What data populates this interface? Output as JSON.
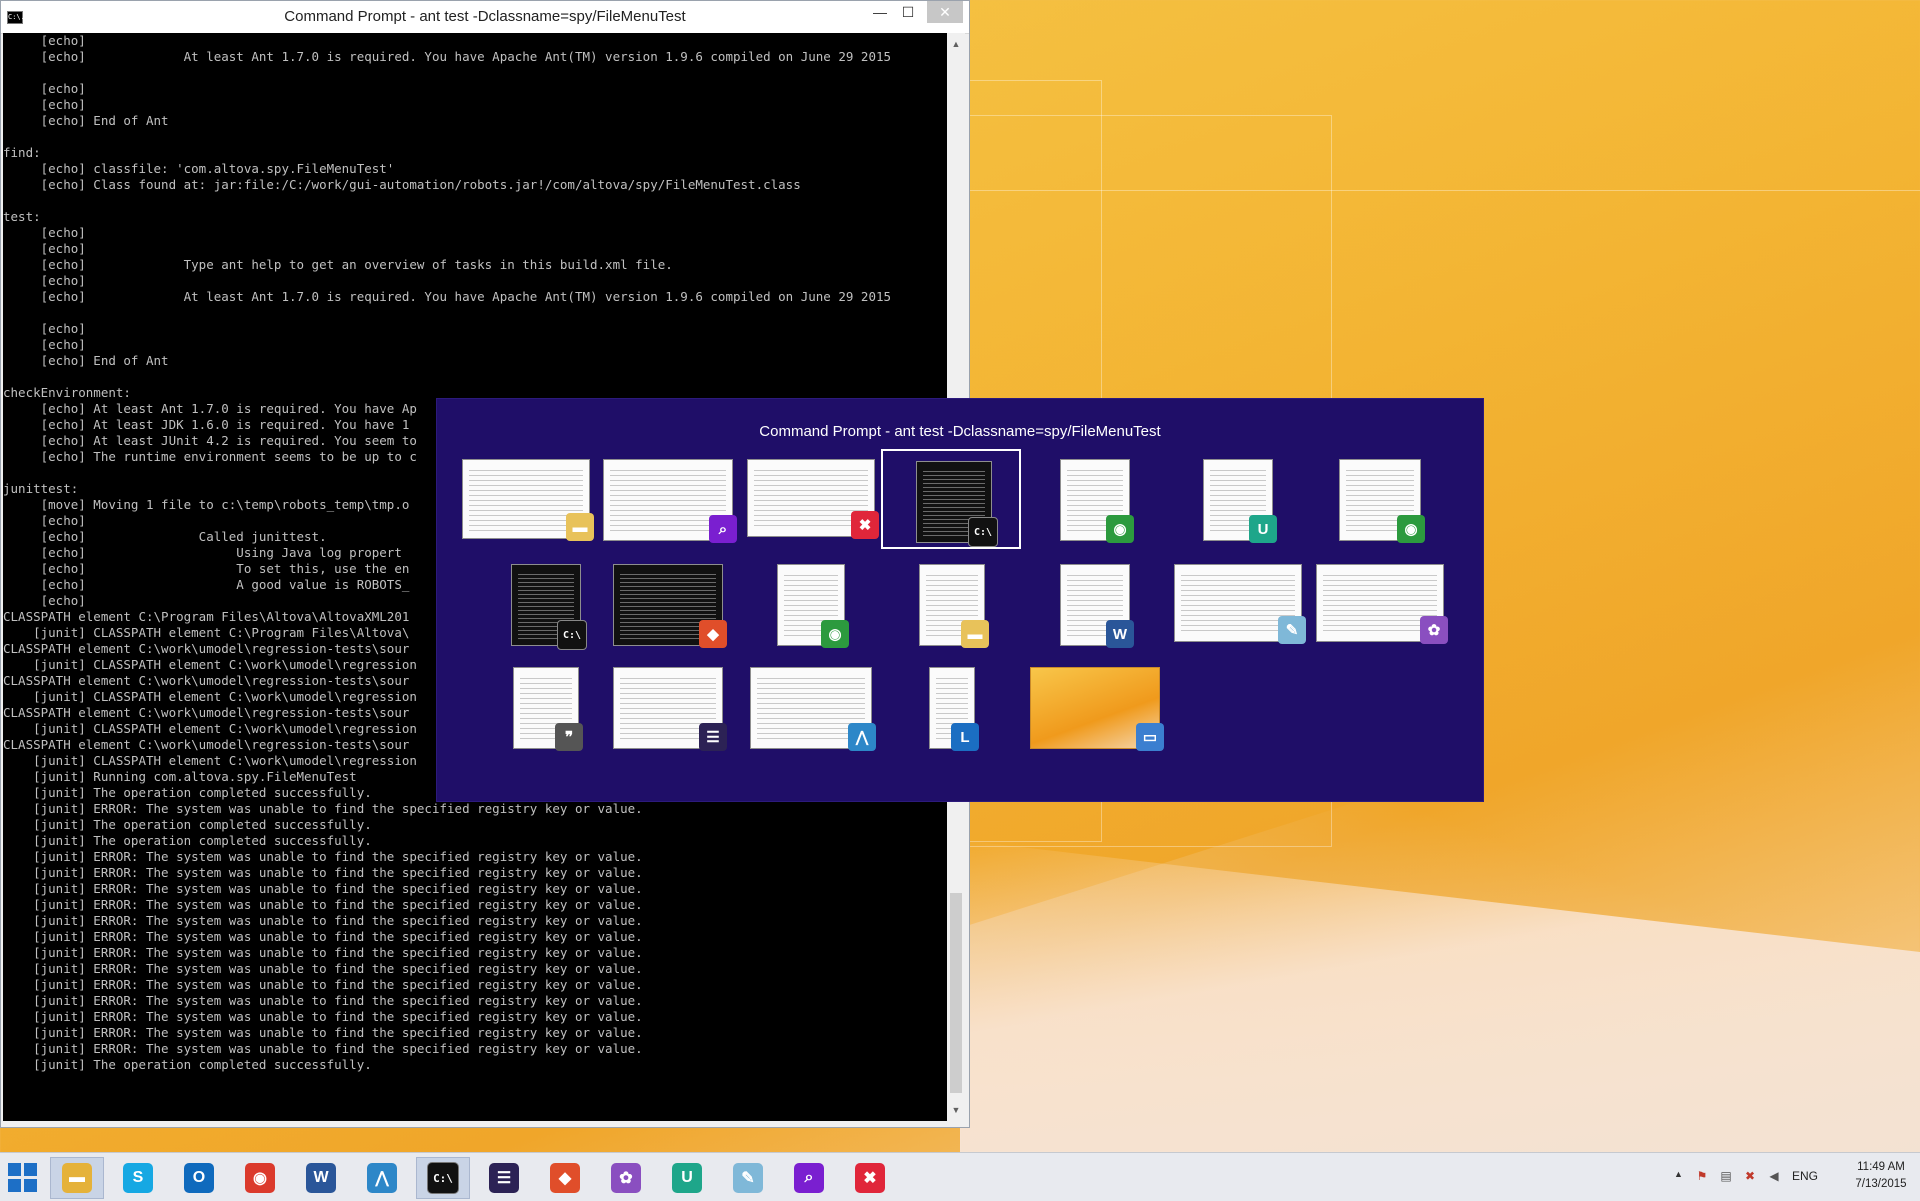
{
  "window": {
    "title": "Command Prompt - ant  test -Dclassname=spy/FileMenuTest",
    "app_icon": "C:\\.",
    "minimize_label": "—",
    "maximize_label": "☐",
    "close_label": "✕"
  },
  "console": {
    "text": "     [echo]\n     [echo]             At least Ant 1.7.0 is required. You have Apache Ant(TM) version 1.9.6 compiled on June 29 2015\n\n     [echo]\n     [echo]\n     [echo] End of Ant\n\nfind:\n     [echo] classfile: 'com.altova.spy.FileMenuTest'\n     [echo] Class found at: jar:file:/C:/work/gui-automation/robots.jar!/com/altova/spy/FileMenuTest.class\n\ntest:\n     [echo]\n     [echo]\n     [echo]             Type ant help to get an overview of tasks in this build.xml file.\n     [echo]\n     [echo]             At least Ant 1.7.0 is required. You have Apache Ant(TM) version 1.9.6 compiled on June 29 2015\n\n     [echo]\n     [echo]\n     [echo] End of Ant\n\ncheckEnvironment:\n     [echo] At least Ant 1.7.0 is required. You have Ap\n     [echo] At least JDK 1.6.0 is required. You have 1\n     [echo] At least JUnit 4.2 is required. You seem to\n     [echo] The runtime environment seems to be up to c\n\njunittest:\n     [move] Moving 1 file to c:\\temp\\robots_temp\\tmp.o\n     [echo]\n     [echo]               Called junittest.\n     [echo]                    Using Java log propert\n     [echo]                    To set this, use the en\n     [echo]                    A good value is ROBOTS_\n     [echo]\nCLASSPATH element C:\\Program Files\\Altova\\AltovaXML201\n    [junit] CLASSPATH element C:\\Program Files\\Altova\\\nCLASSPATH element C:\\work\\umodel\\regression-tests\\sour\n    [junit] CLASSPATH element C:\\work\\umodel\\regression\nCLASSPATH element C:\\work\\umodel\\regression-tests\\sour\n    [junit] CLASSPATH element C:\\work\\umodel\\regression\nCLASSPATH element C:\\work\\umodel\\regression-tests\\sour\n    [junit] CLASSPATH element C:\\work\\umodel\\regression\nCLASSPATH element C:\\work\\umodel\\regression-tests\\sour\n    [junit] CLASSPATH element C:\\work\\umodel\\regression\n    [junit] Running com.altova.spy.FileMenuTest\n    [junit] The operation completed successfully.\n    [junit] ERROR: The system was unable to find the specified registry key or value.\n    [junit] The operation completed successfully.\n    [junit] The operation completed successfully.\n    [junit] ERROR: The system was unable to find the specified registry key or value.\n    [junit] ERROR: The system was unable to find the specified registry key or value.\n    [junit] ERROR: The system was unable to find the specified registry key or value.\n    [junit] ERROR: The system was unable to find the specified registry key or value.\n    [junit] ERROR: The system was unable to find the specified registry key or value.\n    [junit] ERROR: The system was unable to find the specified registry key or value.\n    [junit] ERROR: The system was unable to find the specified registry key or value.\n    [junit] ERROR: The system was unable to find the specified registry key or value.\n    [junit] ERROR: The system was unable to find the specified registry key or value.\n    [junit] ERROR: The system was unable to find the specified registry key or value.\n    [junit] ERROR: The system was unable to find the specified registry key or value.\n    [junit] ERROR: The system was unable to find the specified registry key or value.\n    [junit] ERROR: The system was unable to find the specified registry key or value.\n    [junit] The operation completed successfully."
  },
  "switcher": {
    "title": "Command Prompt - ant  test -Dclassname=spy/FileMenuTest",
    "background": "#1f0e68",
    "items": [
      {
        "name": "explorer-window-thumbnail",
        "icon": "folder-icon",
        "glyph": "▬",
        "color": "#e8c25a",
        "dark": false,
        "selected": false
      },
      {
        "name": "search-app-thumbnail",
        "icon": "magnifier-icon",
        "glyph": "⌕",
        "color": "#7a1fd0",
        "dark": false,
        "selected": false
      },
      {
        "name": "xmlspy-thumbnail",
        "icon": "xmlspy-icon",
        "glyph": "✖",
        "color": "#e0263a",
        "dark": false,
        "selected": false
      },
      {
        "name": "command-prompt-thumbnail",
        "icon": "command-prompt-icon",
        "glyph": "C:\\",
        "color": "#111111",
        "dark": true,
        "selected": true
      },
      {
        "name": "chrome-console-thumbnail",
        "icon": "chrome-icon",
        "glyph": "◉",
        "color": "#2c9a3e",
        "dark": false,
        "selected": false
      },
      {
        "name": "umodel-thumbnail",
        "icon": "umodel-icon",
        "glyph": "U",
        "color": "#1ea68a",
        "dark": false,
        "selected": false
      },
      {
        "name": "chrome-document-thumbnail",
        "icon": "chrome-icon",
        "glyph": "◉",
        "color": "#2c9a3e",
        "dark": false,
        "selected": false
      },
      {
        "name": "command-prompt-2-thumbnail",
        "icon": "command-prompt-icon",
        "glyph": "C:\\",
        "color": "#111111",
        "dark": true,
        "selected": false
      },
      {
        "name": "git-bash-thumbnail",
        "icon": "git-icon",
        "glyph": "◆",
        "color": "#e04e2a",
        "dark": true,
        "selected": false
      },
      {
        "name": "chrome-page-thumbnail",
        "icon": "chrome-icon",
        "glyph": "◉",
        "color": "#2c9a3e",
        "dark": false,
        "selected": false
      },
      {
        "name": "explorer-folder-thumbnail",
        "icon": "folder-icon",
        "glyph": "▬",
        "color": "#e8c25a",
        "dark": false,
        "selected": false
      },
      {
        "name": "word-document-thumbnail",
        "icon": "word-icon",
        "glyph": "W",
        "color": "#2a5699",
        "dark": false,
        "selected": false
      },
      {
        "name": "notepad-thumbnail",
        "icon": "notepad-icon",
        "glyph": "✎",
        "color": "#7fb8d8",
        "dark": false,
        "selected": false
      },
      {
        "name": "paint-app-thumbnail",
        "icon": "paw-icon",
        "glyph": "✿",
        "color": "#8a4fc0",
        "dark": false,
        "selected": false
      },
      {
        "name": "chat-app-thumbnail",
        "icon": "quote-icon",
        "glyph": "❞",
        "color": "#555555",
        "dark": false,
        "selected": false
      },
      {
        "name": "eclipse-thumbnail",
        "icon": "eclipse-icon",
        "glyph": "☰",
        "color": "#2c2255",
        "dark": false,
        "selected": false
      },
      {
        "name": "diffdog-thumbnail",
        "icon": "diff-icon",
        "glyph": "⋀",
        "color": "#2d87c8",
        "dark": false,
        "selected": false
      },
      {
        "name": "lync-thumbnail",
        "icon": "lync-icon",
        "glyph": "L",
        "color": "#1b6ec2",
        "dark": false,
        "selected": false
      },
      {
        "name": "desktop-thumbnail",
        "icon": "desktop-icon",
        "glyph": "▭",
        "color": "#3b7fd0",
        "dark": false,
        "selected": false
      }
    ]
  },
  "taskbar": {
    "background": "#e8eaef",
    "pinned": [
      {
        "name": "taskbar-file-explorer",
        "icon": "folder-icon",
        "glyph": "▬",
        "color": "#e5b23a",
        "active": true
      },
      {
        "name": "taskbar-skype",
        "icon": "skype-icon",
        "glyph": "S",
        "color": "#16a8e3",
        "active": false
      },
      {
        "name": "taskbar-outlook",
        "icon": "outlook-icon",
        "glyph": "O",
        "color": "#0f6abd",
        "active": false
      },
      {
        "name": "taskbar-chrome",
        "icon": "chrome-icon",
        "glyph": "◉",
        "color": "#db3a2c",
        "active": false
      },
      {
        "name": "taskbar-word",
        "icon": "word-icon",
        "glyph": "W",
        "color": "#2a5699",
        "active": false
      },
      {
        "name": "taskbar-diffdog",
        "icon": "diff-icon",
        "glyph": "⋀",
        "color": "#2d87c8",
        "active": false
      },
      {
        "name": "taskbar-command-prompt",
        "icon": "command-prompt-icon",
        "glyph": "C:\\",
        "color": "#111111",
        "active": true
      },
      {
        "name": "taskbar-eclipse",
        "icon": "eclipse-icon",
        "glyph": "☰",
        "color": "#2c2255",
        "active": false
      },
      {
        "name": "taskbar-git",
        "icon": "git-icon",
        "glyph": "◆",
        "color": "#e04e2a",
        "active": false
      },
      {
        "name": "taskbar-paint",
        "icon": "paw-icon",
        "glyph": "✿",
        "color": "#8a4fc0",
        "active": false
      },
      {
        "name": "taskbar-umodel",
        "icon": "umodel-icon",
        "glyph": "U",
        "color": "#1ea68a",
        "active": false
      },
      {
        "name": "taskbar-notepad",
        "icon": "notepad-icon",
        "glyph": "✎",
        "color": "#7fb8d8",
        "active": false
      },
      {
        "name": "taskbar-search-app",
        "icon": "magnifier-icon",
        "glyph": "⌕",
        "color": "#7a1fd0",
        "active": false
      },
      {
        "name": "taskbar-xmlspy",
        "icon": "xmlspy-icon",
        "glyph": "✖",
        "color": "#e0263a",
        "active": false
      }
    ],
    "tray": {
      "language": "ENG",
      "time": "11:49 AM",
      "date": "7/13/2015"
    }
  }
}
